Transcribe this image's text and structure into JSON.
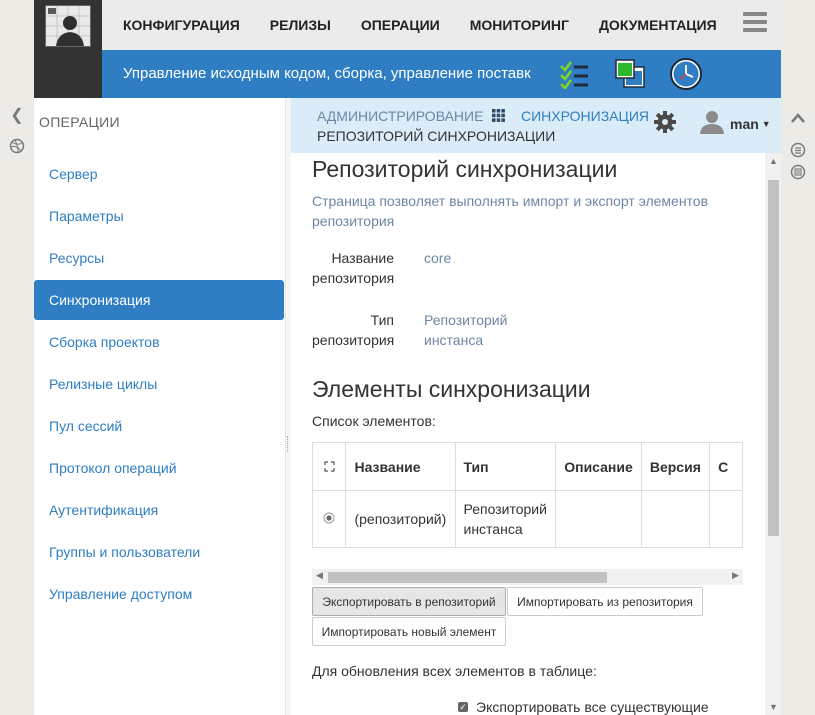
{
  "top_menu": [
    "КОНФИГУРАЦИЯ",
    "РЕЛИЗЫ",
    "ОПЕРАЦИИ",
    "МОНИТОРИНГ",
    "ДОКУМЕНТАЦИЯ"
  ],
  "subtitle": "Управление исходным кодом, сборка, управление поставками",
  "sidebar": {
    "title": "ОПЕРАЦИИ",
    "items": [
      {
        "label": "Сервер"
      },
      {
        "label": "Параметры"
      },
      {
        "label": "Ресурсы"
      },
      {
        "label": "Синхронизация",
        "active": true
      },
      {
        "label": "Сборка проектов"
      },
      {
        "label": "Релизные циклы"
      },
      {
        "label": "Пул сессий"
      },
      {
        "label": "Протокол операций"
      },
      {
        "label": "Аутентификация"
      },
      {
        "label": "Группы и пользователи"
      },
      {
        "label": "Управление доступом"
      }
    ]
  },
  "breadcrumb": {
    "admin": "АДМИНИСТРИРОВАНИЕ",
    "sync": "СИНХРОНИЗАЦИЯ",
    "current": "РЕПОЗИТОРИЙ СИНХРОНИЗАЦИИ"
  },
  "user": {
    "name": "man"
  },
  "page": {
    "title": "Репозиторий синхронизации",
    "description": "Страница позволяет выполнять импорт и экспорт элементов репозитория",
    "repo_name_label": "Название репозитория",
    "repo_name_value": "core",
    "repo_type_label": "Тип репозитория",
    "repo_type_value": "Репозиторий инстанса",
    "section_title": "Элементы синхронизации",
    "list_label": "Список элементов:",
    "table": {
      "headers": [
        "Название",
        "Тип",
        "Описание",
        "Версия",
        "С"
      ],
      "rows": [
        {
          "name": "(репозиторий)",
          "type": "Репозиторий инстанса",
          "description": "",
          "version": "",
          "extra": ""
        }
      ]
    },
    "buttons": {
      "export": "Экспортировать в репозиторий",
      "import": "Импортировать из репозитория",
      "import_new": "Импортировать новый элемент"
    },
    "update_all_label": "Для обновления всех элементов в таблице:",
    "export_all_label": "Экспортировать все существующие"
  },
  "colors": {
    "accent": "#2f7ec3",
    "crumb_bg": "#d9ecf7",
    "dark": "#333333"
  }
}
